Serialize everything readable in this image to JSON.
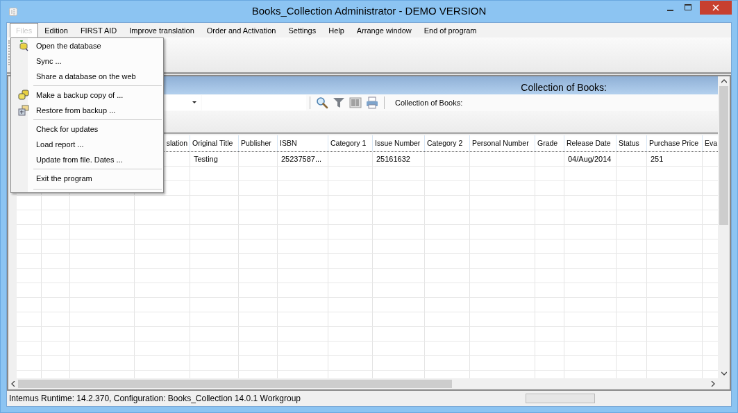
{
  "window": {
    "title": "Books_Collection  Administrator - DEMO VERSION"
  },
  "menubar": [
    {
      "label": "Files",
      "selected": true
    },
    {
      "label": "Edition",
      "selected": false
    },
    {
      "label": "FIRST AID",
      "selected": false
    },
    {
      "label": "Improve translation",
      "selected": false
    },
    {
      "label": "Order and Activation",
      "selected": false
    },
    {
      "label": "Settings",
      "selected": false
    },
    {
      "label": "Help",
      "selected": false
    },
    {
      "label": "Arrange window",
      "selected": false
    },
    {
      "label": "End of program",
      "selected": false
    }
  ],
  "files_menu": [
    [
      {
        "label": "Open the database"
      },
      {
        "label": "Sync ..."
      },
      {
        "label": "Share a database on the web"
      }
    ],
    [
      {
        "label": "Make a backup copy of ..."
      },
      {
        "label": "Restore from backup ..."
      }
    ],
    [
      {
        "label": "Check for updates"
      },
      {
        "label": "Load report ..."
      },
      {
        "label": "Update from file. Dates ..."
      }
    ],
    [
      {
        "label": "Exit the program"
      }
    ]
  ],
  "panel": {
    "header": "Collection of Books:",
    "filter_label": "Collection of Books:"
  },
  "table": {
    "columns": [
      "slation",
      "Original Title",
      "Publisher",
      "ISBN",
      "Category 1",
      "Issue Number",
      "Category 2",
      "Personal Number",
      "Grade",
      "Release Date",
      "Status",
      "Purchase Price",
      "Eva"
    ],
    "rows": [
      [
        null,
        "Testing",
        null,
        "25237587...",
        null,
        "25161632",
        null,
        null,
        null,
        "04/Aug/2014",
        null,
        "251",
        null
      ]
    ]
  },
  "status_bar": {
    "text": "Intemus Runtime: 14.2.370,  Configuration: Books_Collection 14.0.1 Workgroup"
  }
}
